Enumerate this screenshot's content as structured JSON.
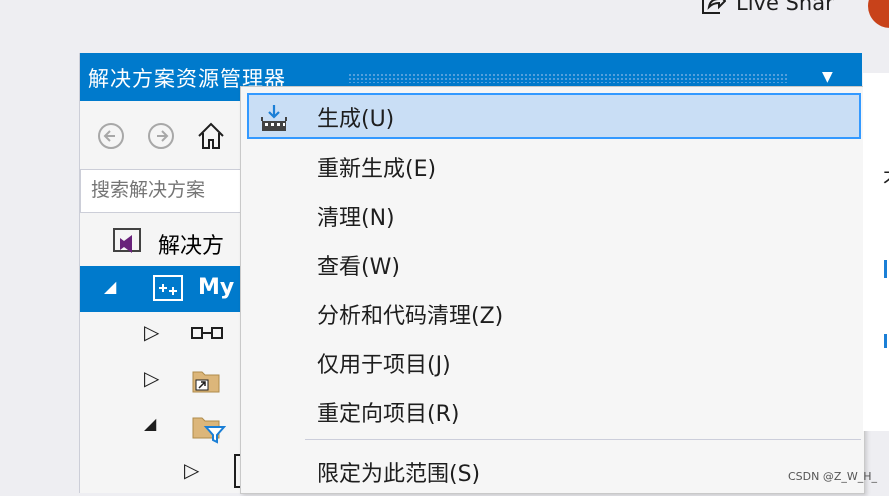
{
  "top": {
    "liveshare_label": "Live Shar"
  },
  "solution_explorer": {
    "title": "解决方案资源管理器",
    "search_placeholder": "搜索解决方案",
    "tree": {
      "solution_label": "解决方",
      "project_label": "My"
    }
  },
  "context_menu": {
    "items": [
      {
        "label": "生成(U)",
        "icon": "build-icon",
        "highlighted": true
      },
      {
        "label": "重新生成(E)"
      },
      {
        "label": "清理(N)"
      },
      {
        "label": "查看(W)"
      },
      {
        "label": "分析和代码清理(Z)"
      },
      {
        "label": "仅用于项目(J)"
      },
      {
        "label": "重定向项目(R)"
      },
      {
        "label": "限定为此范围(S)"
      }
    ]
  },
  "right_panel": {
    "fragment": "才"
  },
  "watermark": "CSDN @Z_W_H_",
  "colors": {
    "accent": "#007acc",
    "highlight_bg": "#c9def5",
    "highlight_border": "#3399ff"
  }
}
